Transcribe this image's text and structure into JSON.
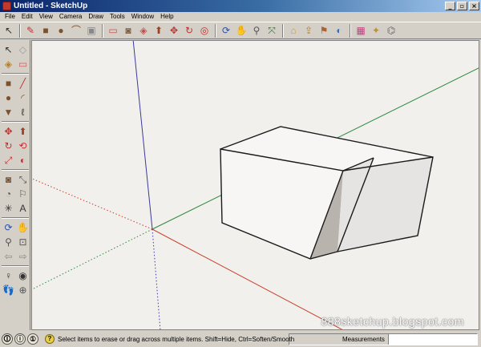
{
  "window": {
    "title": "Untitled - SketchUp"
  },
  "menu": [
    "File",
    "Edit",
    "View",
    "Camera",
    "Draw",
    "Tools",
    "Window",
    "Help"
  ],
  "window_buttons": {
    "minimize": "_",
    "maximize": "▫",
    "close": "×"
  },
  "toolbar_top": [
    {
      "name": "select-icon",
      "glyph": "↖"
    },
    {
      "name": "pencil-line-icon",
      "glyph": "✎"
    },
    {
      "name": "rectangle-icon",
      "glyph": "■"
    },
    {
      "name": "circle-icon",
      "glyph": "●"
    },
    {
      "name": "arc-icon",
      "glyph": "⌒"
    },
    {
      "name": "make-component-icon",
      "glyph": "▣"
    },
    {
      "name": "eraser-icon",
      "glyph": "▭"
    },
    {
      "name": "tape-measure-icon",
      "glyph": "◙"
    },
    {
      "name": "paint-bucket-icon",
      "glyph": "◈"
    },
    {
      "name": "push-pull-icon",
      "glyph": "⬆"
    },
    {
      "name": "move-icon",
      "glyph": "✥"
    },
    {
      "name": "rotate-icon",
      "glyph": "↻"
    },
    {
      "name": "offset-icon",
      "glyph": "◎"
    },
    {
      "name": "orbit-icon",
      "glyph": "⟳"
    },
    {
      "name": "pan-icon",
      "glyph": "✋"
    },
    {
      "name": "zoom-icon",
      "glyph": "⚲"
    },
    {
      "name": "zoom-extents-icon",
      "glyph": "⤧"
    },
    {
      "name": "get-models-icon",
      "glyph": "⌂"
    },
    {
      "name": "share-model-icon",
      "glyph": "⇪"
    },
    {
      "name": "component-icon",
      "glyph": "⚑"
    },
    {
      "name": "google-earth-icon",
      "glyph": "◐"
    },
    {
      "name": "photo-textures-icon",
      "glyph": "▦"
    },
    {
      "name": "extension-icon",
      "glyph": "✦"
    },
    {
      "name": "warehouse-icon",
      "glyph": "⌬"
    }
  ],
  "toolbar_left": [
    {
      "name": "select-tool-icon",
      "glyph": "↖"
    },
    {
      "name": "make-component-tool-icon",
      "glyph": "◇"
    },
    {
      "name": "paint-bucket-tool-icon",
      "glyph": "◈"
    },
    {
      "name": "eraser-tool-icon",
      "glyph": "▭"
    },
    {
      "name": "rectangle-tool-icon",
      "glyph": "■"
    },
    {
      "name": "line-tool-icon",
      "glyph": "╱"
    },
    {
      "name": "circle-tool-icon",
      "glyph": "●"
    },
    {
      "name": "arc-tool-icon",
      "glyph": "◜"
    },
    {
      "name": "polygon-tool-icon",
      "glyph": "▼"
    },
    {
      "name": "freehand-tool-icon",
      "glyph": "ℓ"
    },
    {
      "name": "move-tool-icon",
      "glyph": "✥"
    },
    {
      "name": "push-pull-tool-icon",
      "glyph": "⬆"
    },
    {
      "name": "rotate-tool-icon",
      "glyph": "↻"
    },
    {
      "name": "follow-me-tool-icon",
      "glyph": "⟲"
    },
    {
      "name": "scale-tool-icon",
      "glyph": "⤢"
    },
    {
      "name": "offset-tool-icon",
      "glyph": "◐"
    },
    {
      "name": "tape-measure-tool-icon",
      "glyph": "◙"
    },
    {
      "name": "dimension-tool-icon",
      "glyph": "⤡"
    },
    {
      "name": "protractor-tool-icon",
      "glyph": "◔"
    },
    {
      "name": "text-tool-icon",
      "glyph": "⚐"
    },
    {
      "name": "axes-tool-icon",
      "glyph": "✳"
    },
    {
      "name": "3d-text-tool-icon",
      "glyph": "A"
    },
    {
      "name": "orbit-tool-icon",
      "glyph": "⟳"
    },
    {
      "name": "pan-tool-icon",
      "glyph": "✋"
    },
    {
      "name": "zoom-tool-icon",
      "glyph": "⚲"
    },
    {
      "name": "zoom-window-tool-icon",
      "glyph": "⊡"
    },
    {
      "name": "previous-view-tool-icon",
      "glyph": "⇦"
    },
    {
      "name": "next-view-tool-icon",
      "glyph": "⇨"
    },
    {
      "name": "position-camera-tool-icon",
      "glyph": "♀"
    },
    {
      "name": "look-around-tool-icon",
      "glyph": "◉"
    },
    {
      "name": "walk-tool-icon",
      "glyph": "👣"
    },
    {
      "name": "section-plane-tool-icon",
      "glyph": "⊕"
    }
  ],
  "viewport": {
    "watermark": "888sketchup.blogspot.com"
  },
  "status": {
    "icons": [
      "🛈",
      "ⓘ",
      "①"
    ],
    "help_icon": "?",
    "text": "Select items to erase or drag across multiple items. Shift=Hide, Ctrl=Soften/Smooth",
    "measurements_label": "Measurements",
    "measurements_value": ""
  },
  "colors": {
    "axis_red": "#c8412a",
    "axis_green": "#2e8a3e",
    "axis_blue": "#3a3a9a",
    "face_light": "#f7f6f4",
    "face_shadow": "#b8b3ad",
    "face_side": "#e6e4e2",
    "edge": "#1a1a1a"
  }
}
